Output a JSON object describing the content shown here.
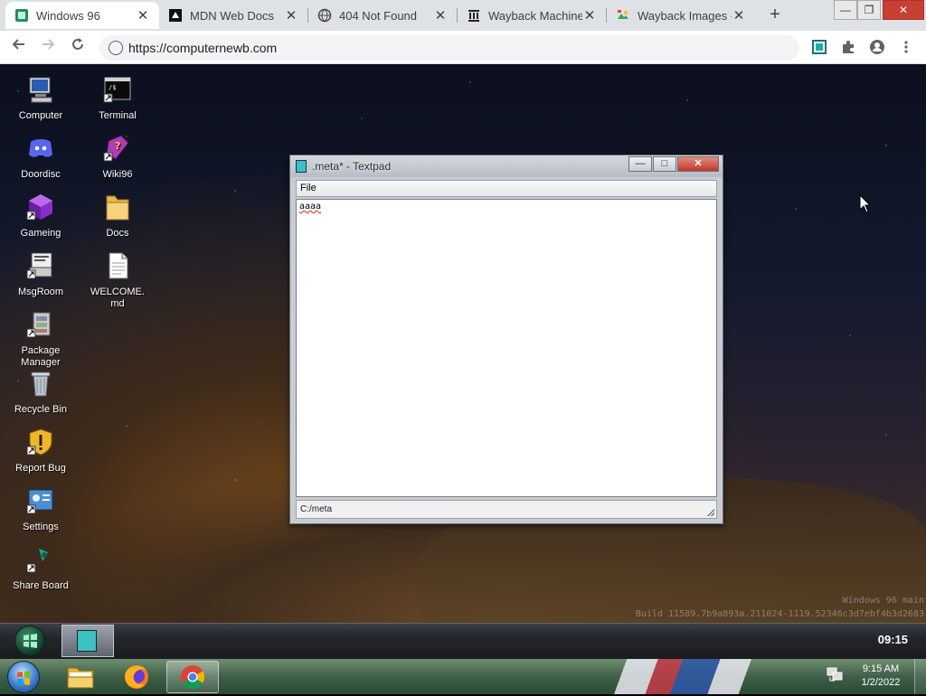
{
  "browser": {
    "tabs": [
      {
        "title": "Windows 96",
        "active": true
      },
      {
        "title": "MDN Web Docs",
        "active": false
      },
      {
        "title": "404 Not Found",
        "active": false
      },
      {
        "title": "Wayback Machine",
        "active": false
      },
      {
        "title": "Wayback Images -",
        "active": false
      }
    ],
    "new_tab": "+",
    "url": "https://computernewb.com",
    "window_controls": {
      "minimize": "—",
      "maximize": "❐",
      "close": "✕"
    }
  },
  "desktop": {
    "icons": [
      {
        "label": "Computer",
        "icon": "computer-icon"
      },
      {
        "label": "Terminal",
        "icon": "terminal-icon"
      },
      {
        "label": "Doordisc",
        "icon": "discord-icon"
      },
      {
        "label": "Wiki96",
        "icon": "wiki-book-icon"
      },
      {
        "label": "Gameing",
        "icon": "game-cube-icon"
      },
      {
        "label": "Docs",
        "icon": "folder-icon"
      },
      {
        "label": "MsgRoom",
        "icon": "msgroom-icon"
      },
      {
        "label": "WELCOME.\nmd",
        "icon": "document-icon"
      },
      {
        "label": "Package\nManager",
        "icon": "package-icon"
      },
      {
        "label": "Recycle Bin",
        "icon": "recycle-bin-icon"
      },
      {
        "label": "Report Bug",
        "icon": "warning-shield-icon"
      },
      {
        "label": "Settings",
        "icon": "settings-icon"
      },
      {
        "label": "Share Board",
        "icon": "share-board-icon"
      }
    ],
    "watermark": {
      "line1": "Windows 96 main",
      "line2": "Build 11589.7b9a893a.211024-1119.52346c3d7ebf4b3d2683"
    }
  },
  "textpad": {
    "title": ".meta* - Textpad",
    "menu": [
      "File"
    ],
    "content": "aaaa",
    "status": "C:/meta",
    "controls": {
      "minimize": "—",
      "maximize": "□",
      "close": "✕"
    }
  },
  "w96_taskbar": {
    "clock": "09:15"
  },
  "host_taskbar": {
    "time": "9:15 AM",
    "date": "1/2/2022"
  }
}
